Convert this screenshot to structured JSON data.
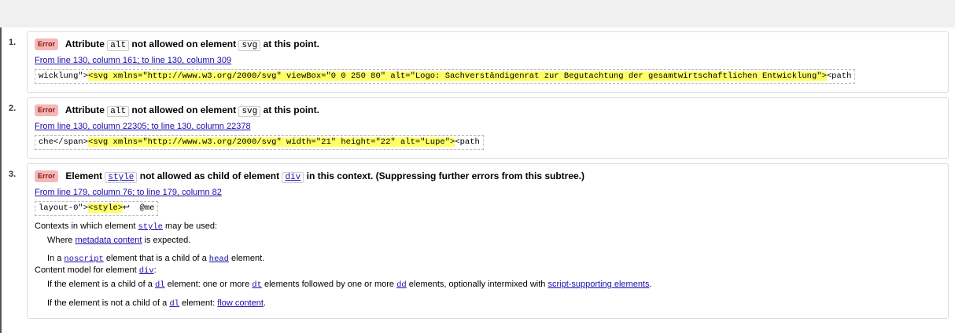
{
  "messages": [
    {
      "number": "1.",
      "badge": "Error",
      "title_parts": [
        "Attribute",
        "alt",
        "not allowed on element",
        "svg",
        "at this point."
      ],
      "location": "From line 130, column 161; to line 130, column 309",
      "extract_before": "wicklung\">",
      "extract_highlight": "<svg xmlns=\"http://www.w3.org/2000/svg\" viewBox=\"0 0 250 80\" alt=\"Logo: Sachverständigenrat zur Begutachtung der gesamtwirtschaftlichen Entwicklung\">",
      "extract_after": "<path"
    },
    {
      "number": "2.",
      "badge": "Error",
      "title_parts": [
        "Attribute",
        "alt",
        "not allowed on element",
        "svg",
        "at this point."
      ],
      "location": "From line 130, column 22305; to line 130, column 22378",
      "extract_before": "che</span>",
      "extract_highlight": "<svg xmlns=\"http://www.w3.org/2000/svg\" width=\"21\" height=\"22\" alt=\"Lupe\">",
      "extract_after": "<path"
    },
    {
      "number": "3.",
      "badge": "Error",
      "title_parts": [
        "Element",
        "style",
        "not allowed as child of element",
        "div",
        "in this context. (Suppressing further errors from this subtree.)"
      ],
      "location": "From line 179, column 76; to line 179, column 82",
      "extract_before": "layout-0\">",
      "extract_highlight": "<style>",
      "extract_after": "↩  @me",
      "details": {
        "contexts_prefix": "Contexts in which element",
        "contexts_element": "style",
        "contexts_suffix": "may be used:",
        "where_prefix": "Where",
        "where_link": "metadata content",
        "where_suffix": "is expected.",
        "in_a_prefix": "In a",
        "in_a_element": "noscript",
        "in_a_middle": "element that is a child of a",
        "in_a_element2": "head",
        "in_a_suffix": "element.",
        "model_prefix": "Content model for element",
        "model_element": "div",
        "model_suffix": ":",
        "if1_prefix": "If the element is a child of a",
        "if1_el1": "dl",
        "if1_mid1": "element: one or more",
        "if1_el2": "dt",
        "if1_mid2": "elements followed by one or more",
        "if1_el3": "dd",
        "if1_mid3": "elements, optionally intermixed with",
        "if1_link": "script-supporting elements",
        "if1_suffix": ".",
        "if2_prefix": "If the element is not a child of a",
        "if2_el": "dl",
        "if2_mid": "element:",
        "if2_link": "flow content",
        "if2_suffix": "."
      }
    }
  ]
}
